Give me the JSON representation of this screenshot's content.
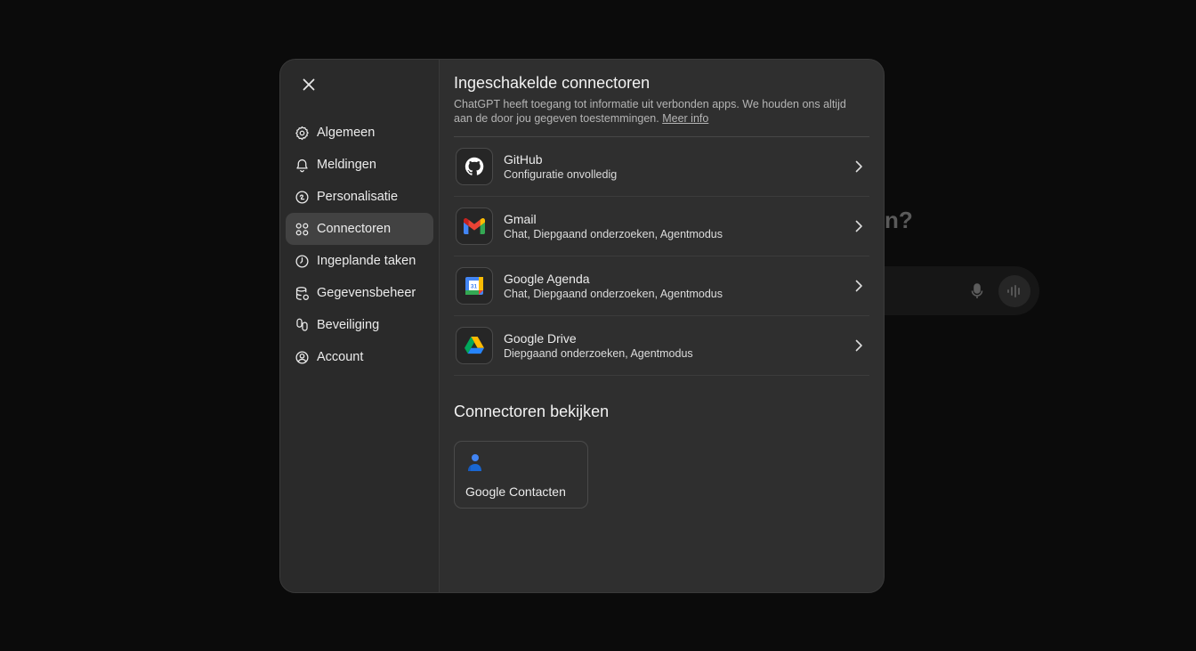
{
  "background": {
    "heading_fragment": "n?"
  },
  "sidebar": {
    "items": [
      {
        "label": "Algemeen",
        "icon": "gear-icon"
      },
      {
        "label": "Meldingen",
        "icon": "bell-icon"
      },
      {
        "label": "Personalisatie",
        "icon": "personalization-icon"
      },
      {
        "label": "Connectoren",
        "icon": "connectors-icon",
        "active": true
      },
      {
        "label": "Ingeplande taken",
        "icon": "clock-icon"
      },
      {
        "label": "Gegevensbeheer",
        "icon": "database-icon"
      },
      {
        "label": "Beveiliging",
        "icon": "security-icon"
      },
      {
        "label": "Account",
        "icon": "account-icon"
      }
    ]
  },
  "main": {
    "enabled_title": "Ingeschakelde connectoren",
    "enabled_desc": "ChatGPT heeft toegang tot informatie uit verbonden apps. We houden ons altijd aan de door jou gegeven toestemmingen.",
    "more_info": "Meer info",
    "connectors": [
      {
        "name": "GitHub",
        "status": "Configuratie onvolledig",
        "icon": "github-icon"
      },
      {
        "name": "Gmail",
        "status": "Chat, Diepgaand onderzoeken, Agentmodus",
        "icon": "gmail-icon"
      },
      {
        "name": "Google Agenda",
        "status": "Chat, Diepgaand onderzoeken, Agentmodus",
        "icon": "google-calendar-icon"
      },
      {
        "name": "Google Drive",
        "status": "Diepgaand onderzoeken, Agentmodus",
        "icon": "google-drive-icon"
      }
    ],
    "browse_title": "Connectoren bekijken",
    "browse_cards": [
      {
        "name": "Google Contacten",
        "icon": "google-contacts-icon"
      }
    ],
    "calendar_day": "31"
  },
  "colors": {
    "background": "#0b0b0b",
    "modal": "#2f2f2f",
    "sidebar": "#2a2a2a",
    "active_item": "#424242"
  }
}
